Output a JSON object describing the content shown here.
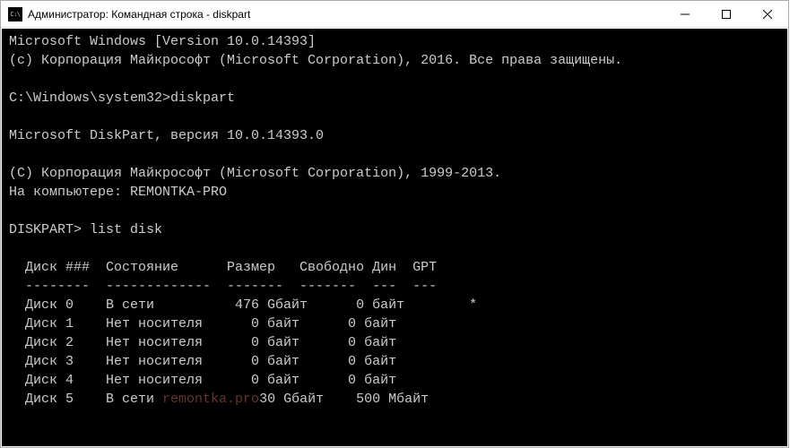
{
  "window": {
    "title": "Администратор: Командная строка - diskpart"
  },
  "console": {
    "line1": "Microsoft Windows [Version 10.0.14393]",
    "line2": "(c) Корпорация Майкрософт (Microsoft Corporation), 2016. Все права защищены.",
    "blank1": "",
    "prompt1": "C:\\Windows\\system32>diskpart",
    "blank2": "",
    "dpver": "Microsoft DiskPart, версия 10.0.14393.0",
    "blank3": "",
    "copyright": "(C) Корпорация Майкрософт (Microsoft Corporation), 1999-2013.",
    "computer": "На компьютере: REMONTKA-PRO",
    "blank4": "",
    "prompt2": "DISKPART> list disk",
    "blank5": "",
    "header": "  Диск ###  Состояние      Размер   Свободно Дин  GPT",
    "divider": "  --------  -------------  -------  -------  ---  ---",
    "row0": "  Диск 0    В сети          476 Gбайт      0 байт        *",
    "row1": "  Диск 1    Нет носителя      0 байт      0 байт",
    "row2": "  Диск 2    Нет носителя      0 байт      0 байт",
    "row3": "  Диск 3    Нет носителя      0 байт      0 байт",
    "row4": "  Диск 4    Нет носителя      0 байт      0 байт",
    "row5a": "  Диск 5    В сети ",
    "watermark": "remontka.pro",
    "row5b": "30 Gбайт    500 Мбайт"
  }
}
